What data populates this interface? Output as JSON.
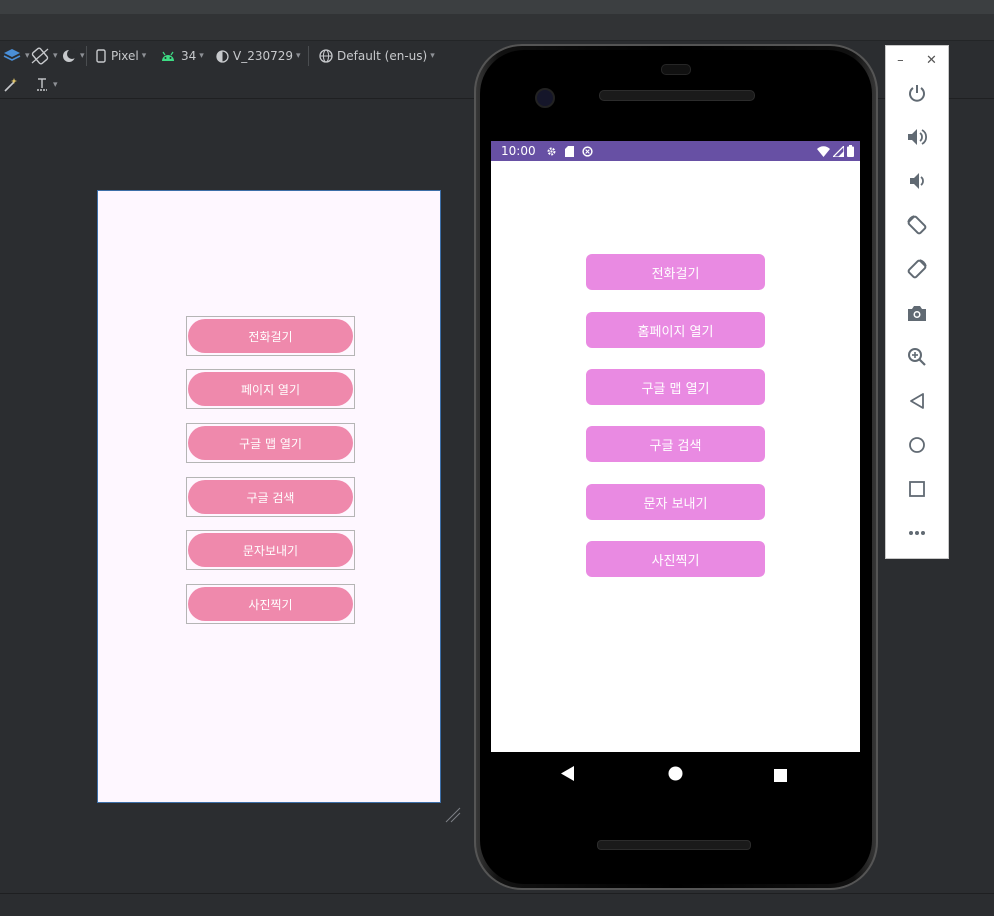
{
  "toolbar": {
    "device": "Pixel",
    "api": "34",
    "theme": "V_230729",
    "locale": "Default (en-us)"
  },
  "preview": {
    "buttons": [
      "전화걸기",
      "페이지 열기",
      "구글 맵 열기",
      "구글 검색",
      "문자보내기",
      "사진찍기"
    ]
  },
  "emulator": {
    "status_time": "10:00",
    "buttons": [
      "전화걸기",
      "홈페이지 열기",
      "구글 맵 열기",
      "구글 검색",
      "문자 보내기",
      "사진찍기"
    ]
  },
  "colors": {
    "preview_button": "#ef89ac",
    "emulator_button": "#e98ae2",
    "status_bar": "#6750a4"
  }
}
